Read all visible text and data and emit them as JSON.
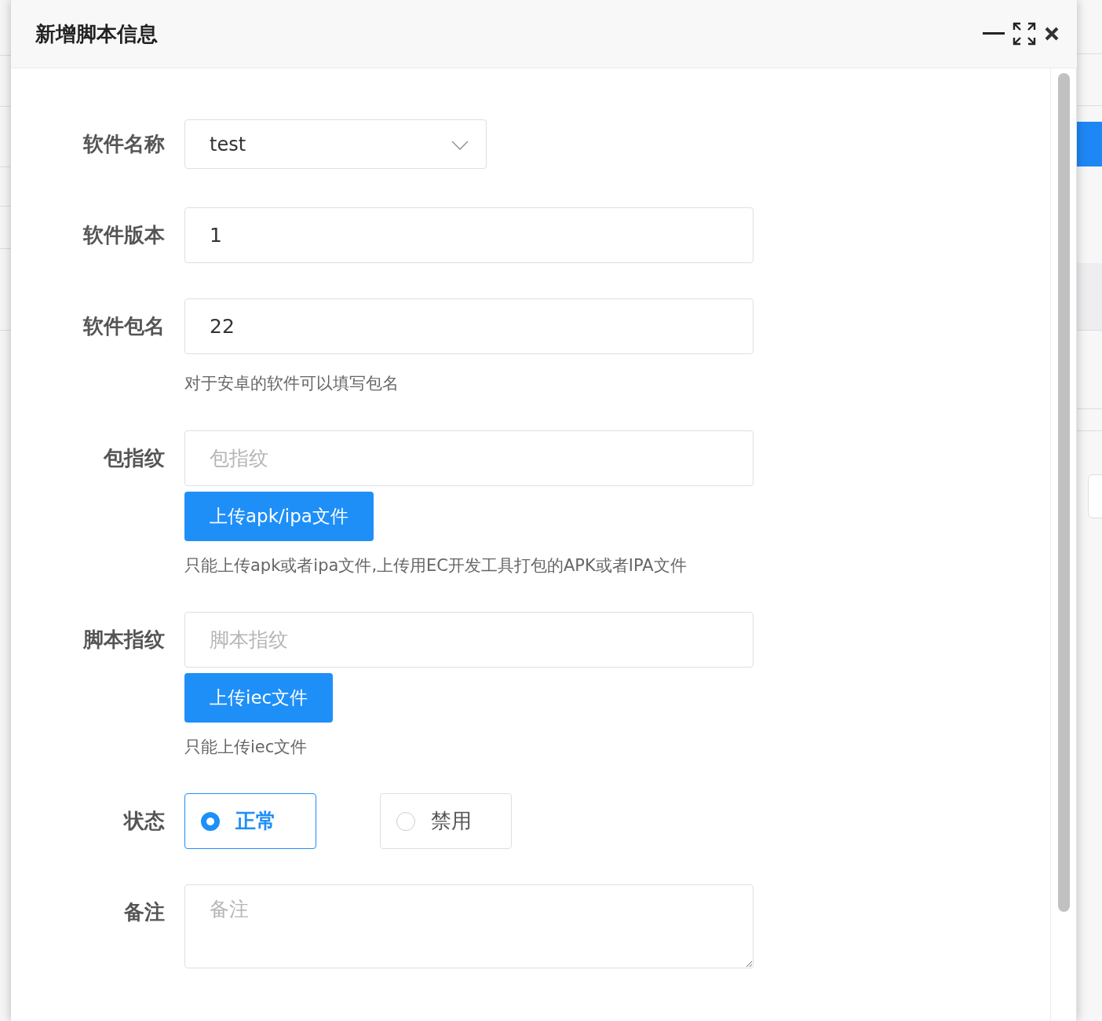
{
  "dialog": {
    "title": "新增脚本信息"
  },
  "form": {
    "fields": [
      {
        "kind": "select",
        "label": "软件名称",
        "value": "test"
      },
      {
        "kind": "input",
        "label": "软件版本",
        "value": "1"
      },
      {
        "kind": "input",
        "label": "软件包名",
        "value": "22",
        "hint": "对于安卓的软件可以填写包名"
      },
      {
        "kind": "input",
        "label": "包指纹",
        "placeholder": "包指纹",
        "button": "上传apk/ipa文件",
        "hint": "只能上传apk或者ipa文件,上传用EC开发工具打包的APK或者IPA文件"
      },
      {
        "kind": "input",
        "label": "脚本指纹",
        "placeholder": "脚本指纹",
        "button": "上传iec文件",
        "hint": "只能上传iec文件"
      },
      {
        "kind": "radio",
        "label": "状态",
        "options": [
          {
            "label": "正常",
            "selected": true
          },
          {
            "label": "禁用",
            "selected": false
          }
        ]
      },
      {
        "kind": "textarea",
        "label": "备注",
        "placeholder": "备注"
      }
    ]
  }
}
